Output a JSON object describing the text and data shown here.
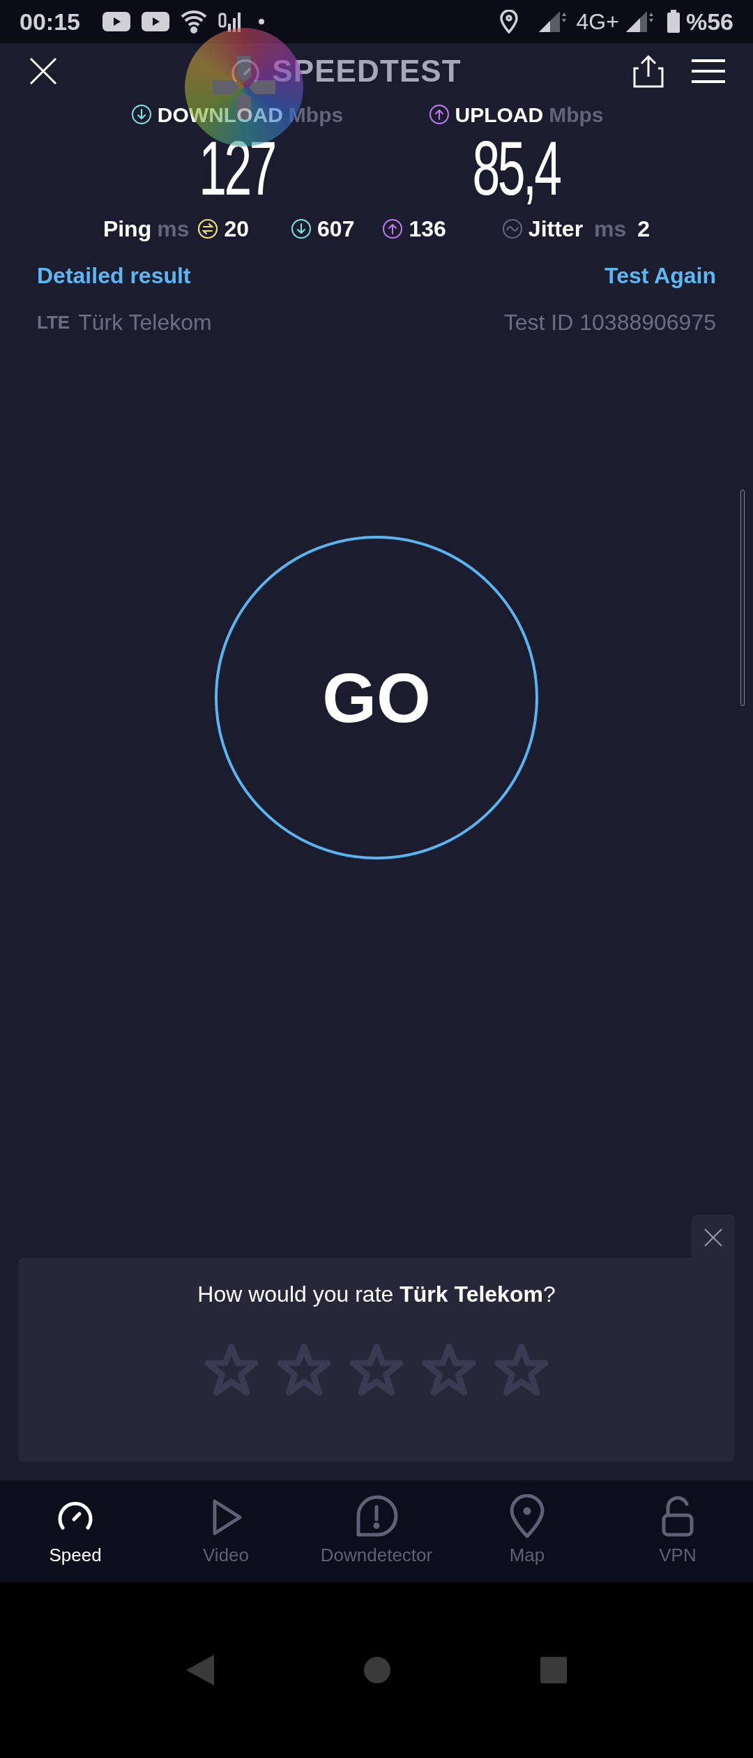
{
  "status_bar": {
    "time": "00:15",
    "network": "4G+",
    "battery": "%56"
  },
  "header": {
    "title": "SPEEDTEST"
  },
  "results": {
    "download": {
      "label": "DOWNLOAD",
      "unit": "Mbps",
      "value": "127"
    },
    "upload": {
      "label": "UPLOAD",
      "unit": "Mbps",
      "value": "85,4"
    },
    "ping": {
      "label": "Ping",
      "unit": "ms",
      "value": "20",
      "download": "607",
      "upload": "136"
    },
    "jitter": {
      "label": "Jitter",
      "unit": "ms",
      "value": "2"
    }
  },
  "links": {
    "detailed": "Detailed result",
    "again": "Test Again"
  },
  "connection": {
    "type": "LTE",
    "provider": "Türk Telekom",
    "test_id": "Test ID 10388906975"
  },
  "go_button": "GO",
  "rating": {
    "question": "How would you rate **Türk Telekom**?",
    "stars": 0
  },
  "nav": [
    {
      "label": "Speed",
      "kind": "speed",
      "selected": true
    },
    {
      "label": "Video",
      "kind": "video",
      "selected": false
    },
    {
      "label": "Downdetector",
      "kind": "alert",
      "selected": false
    },
    {
      "label": "Map",
      "kind": "map",
      "selected": false
    },
    {
      "label": "VPN",
      "kind": "lock",
      "selected": false
    }
  ]
}
